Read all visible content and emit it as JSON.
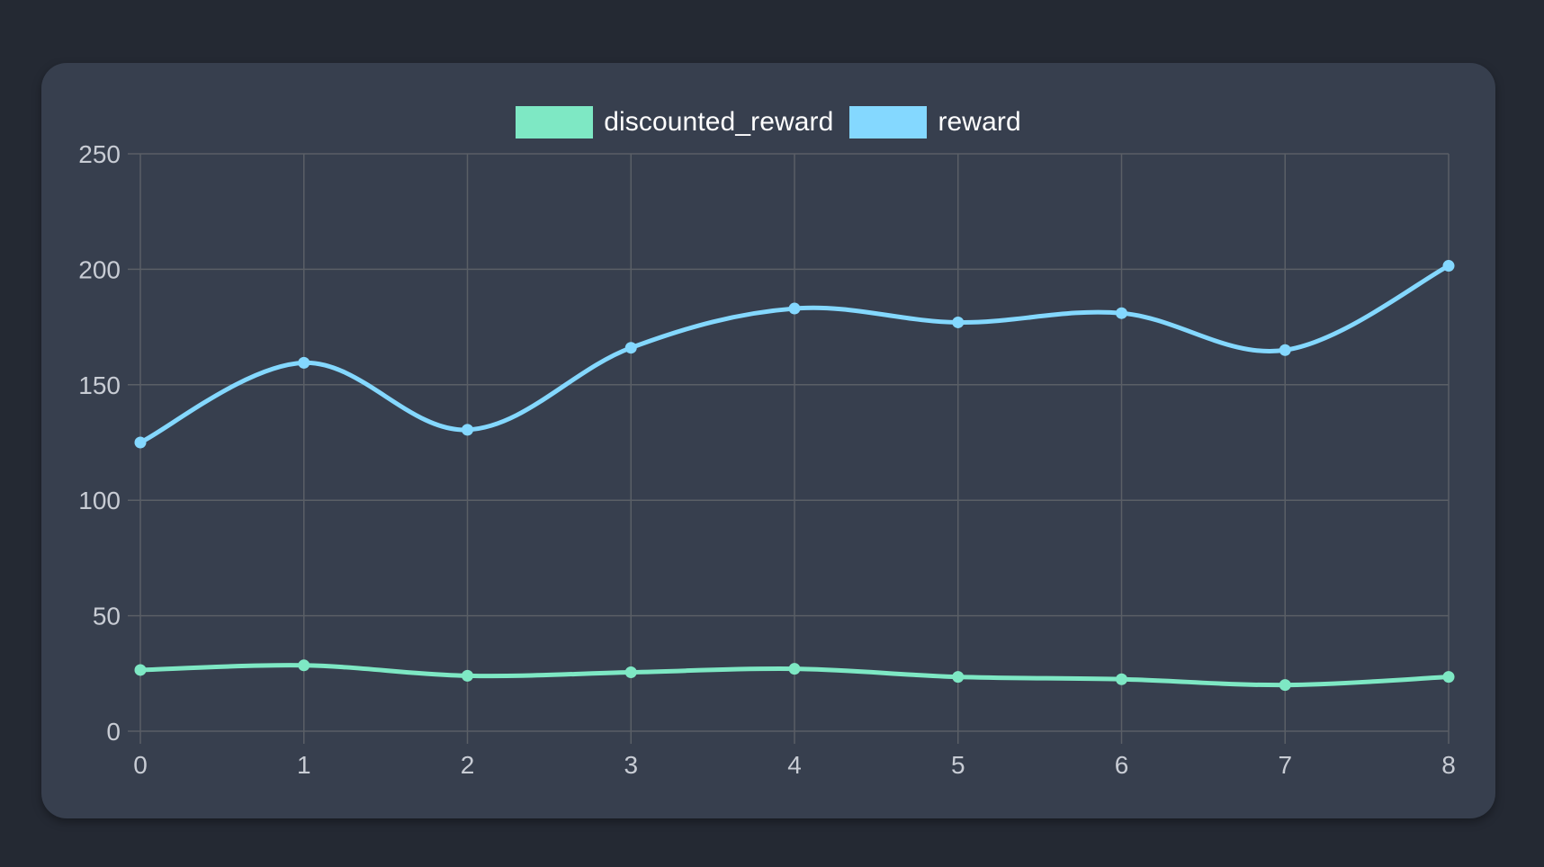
{
  "colors": {
    "page_background": "#242933",
    "card_background": "#373f4e",
    "grid": "#5a5f66",
    "tick_text": "#c8ccd4",
    "legend_text": "#ffffff"
  },
  "chart_data": {
    "type": "line",
    "x": [
      0,
      1,
      2,
      3,
      4,
      5,
      6,
      7,
      8
    ],
    "xlim": [
      0,
      8
    ],
    "ylim": [
      0,
      250
    ],
    "y_ticks": [
      0,
      50,
      100,
      150,
      200,
      250
    ],
    "grid": true,
    "legend_position": "top-center",
    "smooth": true,
    "series": [
      {
        "name": "discounted_reward",
        "color": "#7ee8c4",
        "values": [
          26.5,
          28.5,
          24,
          25.5,
          27,
          23.5,
          22.5,
          20,
          23.5
        ]
      },
      {
        "name": "reward",
        "color": "#84d8ff",
        "values": [
          125,
          159.5,
          130.5,
          166,
          183,
          177,
          181,
          165,
          201.5
        ]
      }
    ]
  }
}
